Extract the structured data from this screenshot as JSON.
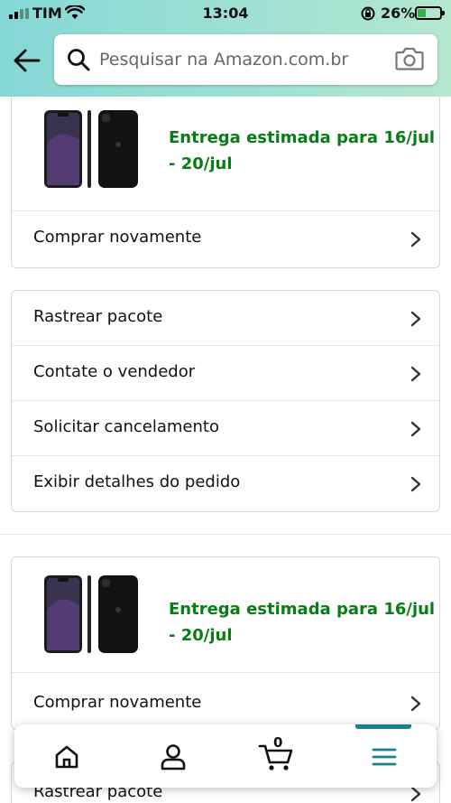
{
  "status_bar": {
    "carrier": "TIM",
    "time": "13:04",
    "battery": "26%",
    "battery_level": 0.26
  },
  "header": {
    "back_icon": "arrow-left-icon",
    "search": {
      "placeholder": "Pesquisar na Amazon.com.br",
      "value": ""
    },
    "camera_icon": "camera-icon"
  },
  "orders": [
    {
      "delivery_text": "Entrega estimada para 16/jul\n- 20/jul",
      "delivery_line1": "Entrega estimada para 16/jul",
      "delivery_line2": "- 20/jul",
      "buy_again": "Comprar novamente",
      "actions": [
        "Rastrear pacote",
        "Contate o vendedor",
        "Solicitar cancelamento",
        "Exibir detalhes do pedido"
      ]
    },
    {
      "delivery_line1": "Entrega estimada para 16/jul",
      "delivery_line2": "- 20/jul",
      "buy_again": "Comprar novamente",
      "actions": [
        "Rastrear pacote"
      ]
    }
  ],
  "bottom_nav": {
    "items": [
      "home-icon",
      "account-icon",
      "cart-icon",
      "menu-icon"
    ],
    "cart_count": "0",
    "active": "menu"
  },
  "colors": {
    "header_start": "#85d8d6",
    "header_end": "#b5e7cf",
    "delivery_green": "#067d15",
    "nav_accent": "#19828f"
  }
}
